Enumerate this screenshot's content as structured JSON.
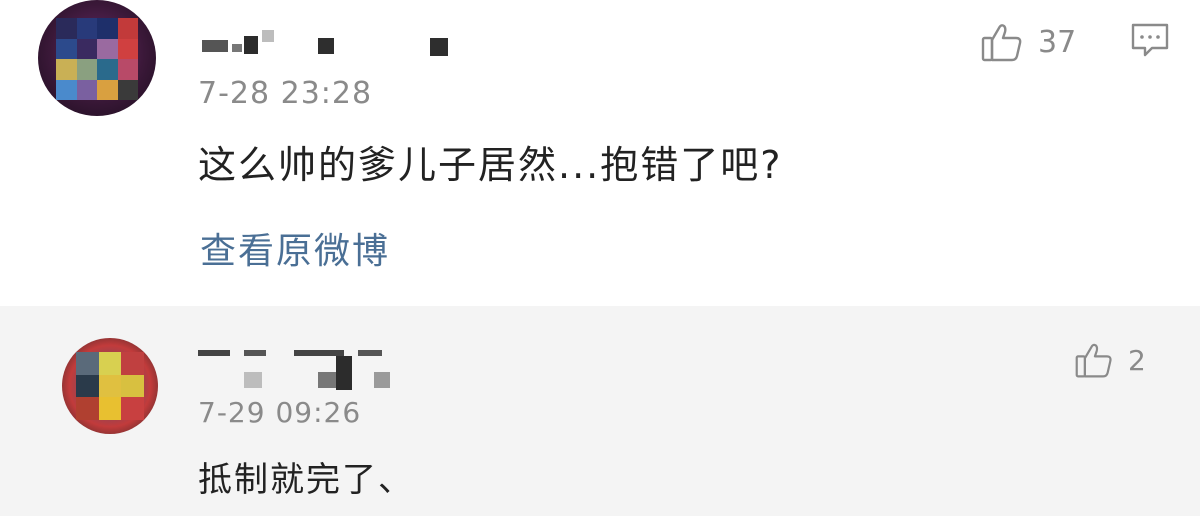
{
  "comments": [
    {
      "time": "7-28 23:28",
      "text": "这么帅的爹儿子居然...抱错了吧?",
      "likes": "37",
      "view_original_label": "查看原微博",
      "avatar_colors": [
        "#2a2a5a",
        "#283a7a",
        "#1e2f6a",
        "#c23a3a",
        "#2c4a8c",
        "#3a2a60",
        "#9a6aa0",
        "#d04040",
        "#c9b055",
        "#8aa080",
        "#2a6a8c",
        "#b84a68",
        "#4a8acc",
        "#7a60a0",
        "#d9a040",
        "#3a3a3a"
      ]
    },
    {
      "time": "7-29 09:26",
      "text": "抵制就完了、",
      "likes": "2",
      "avatar_colors": [
        "#5a6a7a",
        "#d8d050",
        "#c04040",
        "#2a3a4a",
        "#e0c040",
        "#d8c040",
        "#b04030",
        "#e8c030",
        "#c84040"
      ]
    }
  ],
  "icons": {
    "like": "thumbs-up-icon",
    "reply": "comment-icon"
  },
  "colors": {
    "text": "#222222",
    "meta": "#8a8a8a",
    "link": "#4a6f95",
    "alt_bg": "#f4f4f4"
  }
}
